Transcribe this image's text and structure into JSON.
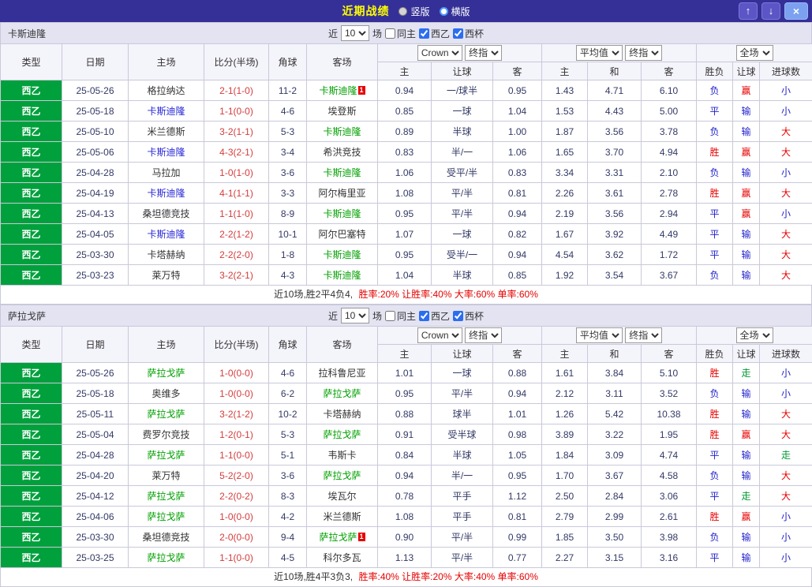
{
  "topbar": {
    "title": "近期战绩",
    "radio_vertical": "竖版",
    "radio_horizontal": "横版",
    "up_icon": "↑",
    "down_icon": "↓",
    "close_icon": "×"
  },
  "filter": {
    "near": "近",
    "games": "场",
    "same_venue": "同主",
    "league": "西乙",
    "cup": "西杯"
  },
  "table_header": {
    "type": "类型",
    "date": "日期",
    "home": "主场",
    "score": "比分(半场)",
    "corner": "角球",
    "away": "客场",
    "odds_source_select": "Crown",
    "final_select": "终指",
    "avg_select": "平均值",
    "scope_select": "全场",
    "odds_cols": [
      "主",
      "让球",
      "客"
    ],
    "avg_cols": [
      "主",
      "和",
      "客"
    ],
    "result_cols": [
      "胜负",
      "让球",
      "进球数"
    ]
  },
  "result_colors": {
    "胜": "#e60000",
    "平": "#2222cc",
    "负": "#2222cc",
    "赢": "#e60000",
    "输": "#2222cc",
    "走": "#009933",
    "大": "#e60000",
    "小": "#2222cc"
  },
  "sections": [
    {
      "team": "卡斯迪隆",
      "filter_count": "10",
      "checkboxes": {
        "same_venue": false,
        "league": true,
        "cup": true
      },
      "rows": [
        {
          "league": "西乙",
          "date": "25-05-26",
          "home": "格拉纳达",
          "home_style": "plain",
          "away": "卡斯迪隆",
          "away_style": "green",
          "away_badge": "1",
          "score": "2-1(1-0)",
          "corners": "11-2",
          "odds": [
            "0.94",
            "一/球半",
            "0.95"
          ],
          "avg": [
            "1.43",
            "4.71",
            "6.10"
          ],
          "results": [
            "负",
            "赢",
            "小"
          ]
        },
        {
          "league": "西乙",
          "date": "25-05-18",
          "home": "卡斯迪隆",
          "home_style": "blue",
          "away": "埃登斯",
          "away_style": "plain",
          "score": "1-1(0-0)",
          "corners": "4-6",
          "odds": [
            "0.85",
            "一球",
            "1.04"
          ],
          "avg": [
            "1.53",
            "4.43",
            "5.00"
          ],
          "results": [
            "平",
            "输",
            "小"
          ]
        },
        {
          "league": "西乙",
          "date": "25-05-10",
          "home": "米兰德斯",
          "home_style": "plain",
          "away": "卡斯迪隆",
          "away_style": "green",
          "score": "3-2(1-1)",
          "corners": "5-3",
          "odds": [
            "0.89",
            "半球",
            "1.00"
          ],
          "avg": [
            "1.87",
            "3.56",
            "3.78"
          ],
          "results": [
            "负",
            "输",
            "大"
          ]
        },
        {
          "league": "西乙",
          "date": "25-05-06",
          "home": "卡斯迪隆",
          "home_style": "blue",
          "away": "希洪竞技",
          "away_style": "plain",
          "score": "4-3(2-1)",
          "corners": "3-4",
          "odds": [
            "0.83",
            "半/一",
            "1.06"
          ],
          "avg": [
            "1.65",
            "3.70",
            "4.94"
          ],
          "results": [
            "胜",
            "赢",
            "大"
          ]
        },
        {
          "league": "西乙",
          "date": "25-04-28",
          "home": "马拉加",
          "home_style": "plain",
          "away": "卡斯迪隆",
          "away_style": "green",
          "score": "1-0(1-0)",
          "corners": "3-6",
          "odds": [
            "1.06",
            "受平/半",
            "0.83"
          ],
          "avg": [
            "3.34",
            "3.31",
            "2.10"
          ],
          "results": [
            "负",
            "输",
            "小"
          ]
        },
        {
          "league": "西乙",
          "date": "25-04-19",
          "home": "卡斯迪隆",
          "home_style": "blue",
          "away": "阿尔梅里亚",
          "away_style": "plain",
          "score": "4-1(1-1)",
          "corners": "3-3",
          "odds": [
            "1.08",
            "平/半",
            "0.81"
          ],
          "avg": [
            "2.26",
            "3.61",
            "2.78"
          ],
          "results": [
            "胜",
            "赢",
            "大"
          ]
        },
        {
          "league": "西乙",
          "date": "25-04-13",
          "home": "桑坦德竞技",
          "home_style": "plain",
          "away": "卡斯迪隆",
          "away_style": "green",
          "score": "1-1(1-0)",
          "corners": "8-9",
          "odds": [
            "0.95",
            "平/半",
            "0.94"
          ],
          "avg": [
            "2.19",
            "3.56",
            "2.94"
          ],
          "results": [
            "平",
            "赢",
            "小"
          ]
        },
        {
          "league": "西乙",
          "date": "25-04-05",
          "home": "卡斯迪隆",
          "home_style": "blue",
          "away": "阿尔巴塞特",
          "away_style": "plain",
          "score": "2-2(1-2)",
          "corners": "10-1",
          "odds": [
            "1.07",
            "一球",
            "0.82"
          ],
          "avg": [
            "1.67",
            "3.92",
            "4.49"
          ],
          "results": [
            "平",
            "输",
            "大"
          ]
        },
        {
          "league": "西乙",
          "date": "25-03-30",
          "home": "卡塔赫纳",
          "home_style": "plain",
          "away": "卡斯迪隆",
          "away_style": "green",
          "score": "2-2(2-0)",
          "corners": "1-8",
          "odds": [
            "0.95",
            "受半/一",
            "0.94"
          ],
          "avg": [
            "4.54",
            "3.62",
            "1.72"
          ],
          "results": [
            "平",
            "输",
            "大"
          ]
        },
        {
          "league": "西乙",
          "date": "25-03-23",
          "home": "莱万特",
          "home_style": "plain",
          "away": "卡斯迪隆",
          "away_style": "green",
          "score": "3-2(2-1)",
          "corners": "4-3",
          "odds": [
            "1.04",
            "半球",
            "0.85"
          ],
          "avg": [
            "1.92",
            "3.54",
            "3.67"
          ],
          "results": [
            "负",
            "输",
            "大"
          ]
        }
      ],
      "summary_prefix": "近10场,胜2平4负4,",
      "summary_stats": "胜率:20% 让胜率:40% 大率:60% 单率:60%"
    },
    {
      "team": "萨拉戈萨",
      "filter_count": "10",
      "checkboxes": {
        "same_venue": false,
        "league": true,
        "cup": true
      },
      "rows": [
        {
          "league": "西乙",
          "date": "25-05-26",
          "home": "萨拉戈萨",
          "home_style": "green",
          "away": "拉科鲁尼亚",
          "away_style": "plain",
          "score": "1-0(0-0)",
          "corners": "4-6",
          "odds": [
            "1.01",
            "一球",
            "0.88"
          ],
          "avg": [
            "1.61",
            "3.84",
            "5.10"
          ],
          "results": [
            "胜",
            "走",
            "小"
          ]
        },
        {
          "league": "西乙",
          "date": "25-05-18",
          "home": "奥维多",
          "home_style": "plain",
          "away": "萨拉戈萨",
          "away_style": "green",
          "score": "1-0(0-0)",
          "corners": "6-2",
          "odds": [
            "0.95",
            "平/半",
            "0.94"
          ],
          "avg": [
            "2.12",
            "3.11",
            "3.52"
          ],
          "results": [
            "负",
            "输",
            "小"
          ]
        },
        {
          "league": "西乙",
          "date": "25-05-11",
          "home": "萨拉戈萨",
          "home_style": "green",
          "away": "卡塔赫纳",
          "away_style": "plain",
          "score": "3-2(1-2)",
          "corners": "10-2",
          "odds": [
            "0.88",
            "球半",
            "1.01"
          ],
          "avg": [
            "1.26",
            "5.42",
            "10.38"
          ],
          "results": [
            "胜",
            "输",
            "大"
          ]
        },
        {
          "league": "西乙",
          "date": "25-05-04",
          "home": "费罗尔竞技",
          "home_style": "plain",
          "away": "萨拉戈萨",
          "away_style": "green",
          "score": "1-2(0-1)",
          "corners": "5-3",
          "odds": [
            "0.91",
            "受半球",
            "0.98"
          ],
          "avg": [
            "3.89",
            "3.22",
            "1.95"
          ],
          "results": [
            "胜",
            "赢",
            "大"
          ]
        },
        {
          "league": "西乙",
          "date": "25-04-28",
          "home": "萨拉戈萨",
          "home_style": "green",
          "away": "韦斯卡",
          "away_style": "plain",
          "score": "1-1(0-0)",
          "corners": "5-1",
          "odds": [
            "0.84",
            "半球",
            "1.05"
          ],
          "avg": [
            "1.84",
            "3.09",
            "4.74"
          ],
          "results": [
            "平",
            "输",
            "走"
          ]
        },
        {
          "league": "西乙",
          "date": "25-04-20",
          "home": "莱万特",
          "home_style": "plain",
          "away": "萨拉戈萨",
          "away_style": "green",
          "score": "5-2(2-0)",
          "corners": "3-6",
          "odds": [
            "0.94",
            "半/一",
            "0.95"
          ],
          "avg": [
            "1.70",
            "3.67",
            "4.58"
          ],
          "results": [
            "负",
            "输",
            "大"
          ]
        },
        {
          "league": "西乙",
          "date": "25-04-12",
          "home": "萨拉戈萨",
          "home_style": "green",
          "away": "埃瓦尔",
          "away_style": "plain",
          "score": "2-2(0-2)",
          "corners": "8-3",
          "odds": [
            "0.78",
            "平手",
            "1.12"
          ],
          "avg": [
            "2.50",
            "2.84",
            "3.06"
          ],
          "results": [
            "平",
            "走",
            "大"
          ]
        },
        {
          "league": "西乙",
          "date": "25-04-06",
          "home": "萨拉戈萨",
          "home_style": "green",
          "away": "米兰德斯",
          "away_style": "plain",
          "score": "1-0(0-0)",
          "corners": "4-2",
          "odds": [
            "1.08",
            "平手",
            "0.81"
          ],
          "avg": [
            "2.79",
            "2.99",
            "2.61"
          ],
          "results": [
            "胜",
            "赢",
            "小"
          ]
        },
        {
          "league": "西乙",
          "date": "25-03-30",
          "home": "桑坦德竞技",
          "home_style": "plain",
          "away": "萨拉戈萨",
          "away_style": "green",
          "away_badge": "1",
          "score": "2-0(0-0)",
          "corners": "9-4",
          "odds": [
            "0.90",
            "平/半",
            "0.99"
          ],
          "avg": [
            "1.85",
            "3.50",
            "3.98"
          ],
          "results": [
            "负",
            "输",
            "小"
          ]
        },
        {
          "league": "西乙",
          "date": "25-03-25",
          "home": "萨拉戈萨",
          "home_style": "green",
          "away": "科尔多瓦",
          "away_style": "plain",
          "score": "1-1(0-0)",
          "corners": "4-5",
          "odds": [
            "1.13",
            "平/半",
            "0.77"
          ],
          "avg": [
            "2.27",
            "3.15",
            "3.16"
          ],
          "results": [
            "平",
            "输",
            "小"
          ]
        }
      ],
      "summary_prefix": "近10场,胜4平3负3,",
      "summary_stats": "胜率:40% 让胜率:20% 大率:40% 单率:60%"
    }
  ]
}
